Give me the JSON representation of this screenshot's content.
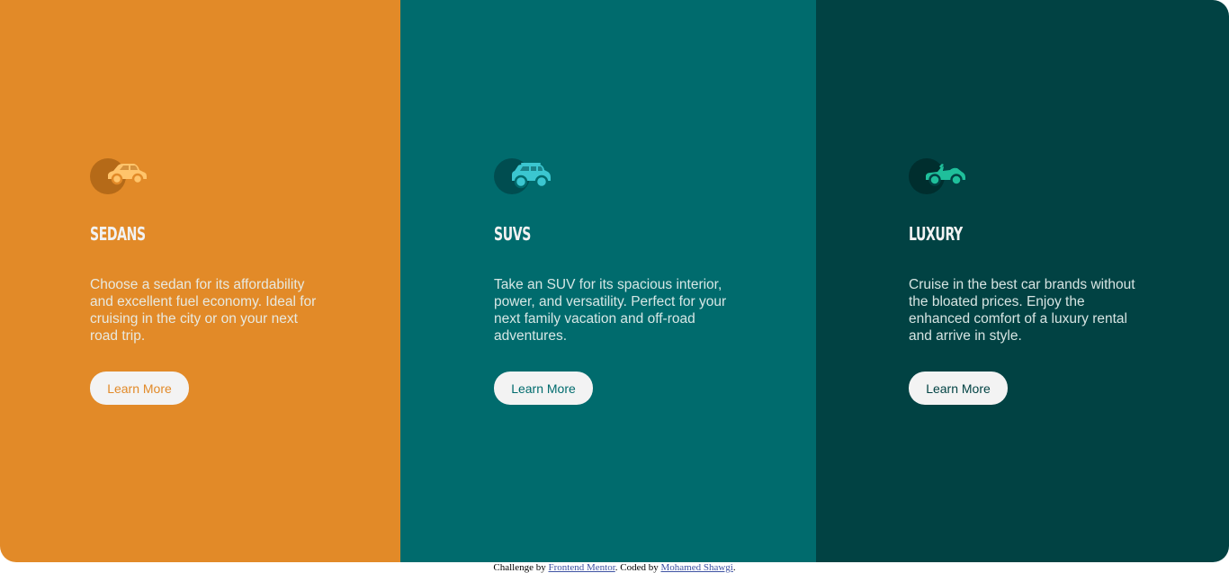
{
  "cards": [
    {
      "icon": "sedan-car-icon",
      "title": "SEDANS",
      "description": "Choose a sedan for its affordability and excellent fuel economy. Ideal for cruising in the city or on your next road trip.",
      "button_label": "Learn More",
      "color": "#e28a28",
      "icon_color": "#ffc46b"
    },
    {
      "icon": "suv-car-icon",
      "title": "SUVS",
      "description": "Take an SUV for its spacious interior, power, and versatility. Perfect for your next family vacation and off-road adventures.",
      "button_label": "Learn More",
      "color": "#006b6d",
      "icon_color": "#3bc6d0"
    },
    {
      "icon": "luxury-car-icon",
      "title": "LUXURY",
      "description": "Cruise in the best car brands without the bloated prices. Enjoy the enhanced comfort of a luxury rental and arrive in style.",
      "button_label": "Learn More",
      "color": "#014243",
      "icon_color": "#1fbf9b"
    }
  ],
  "attribution": {
    "prefix": "Challenge by ",
    "challenge_link": "Frontend Mentor",
    "middle": ". Coded by ",
    "author_link": "Mohamed Shawgi",
    "suffix": "."
  }
}
